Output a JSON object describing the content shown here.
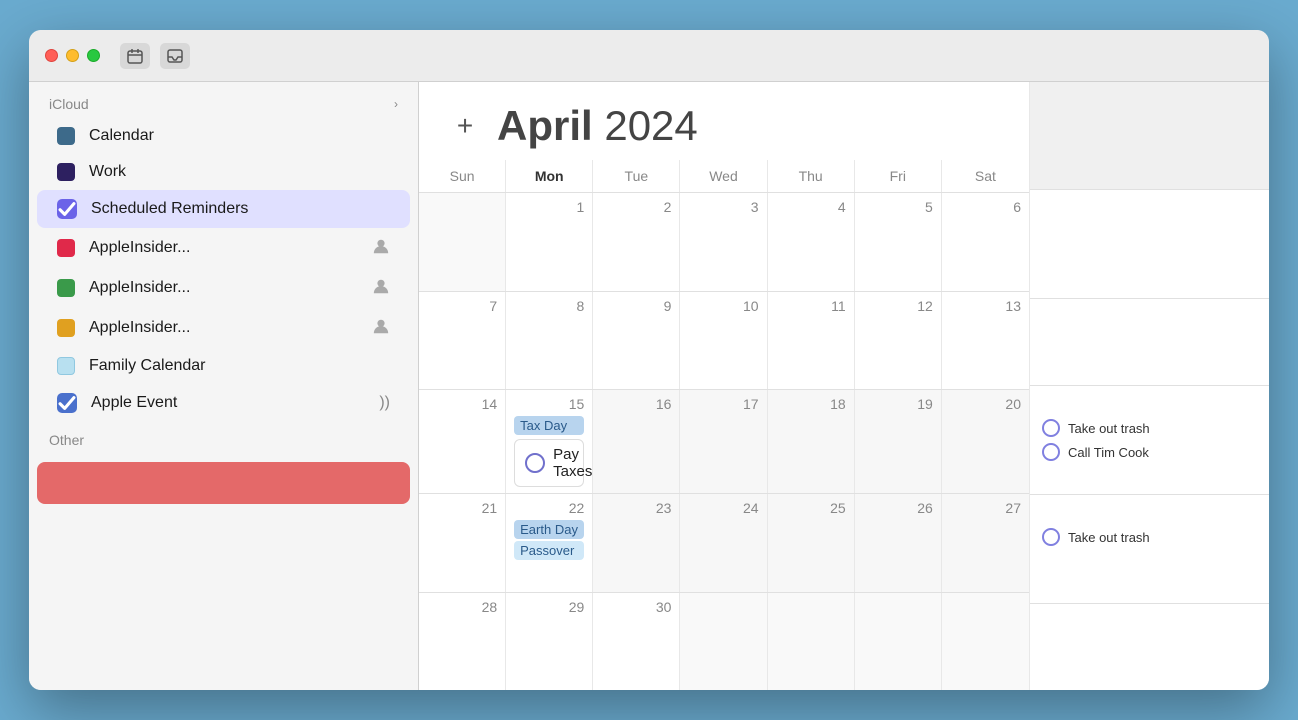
{
  "window": {
    "title": "Calendar"
  },
  "titlebar": {
    "close_label": "",
    "minimize_label": "",
    "maximize_label": ""
  },
  "sidebar": {
    "icloud_section": "iCloud",
    "chevron": "›",
    "items": [
      {
        "id": "calendar",
        "label": "Calendar",
        "color": "#3d6a8a",
        "type": "dot"
      },
      {
        "id": "work",
        "label": "Work",
        "color": "#2d2060",
        "type": "dot"
      },
      {
        "id": "scheduled-reminders",
        "label": "Scheduled Reminders",
        "color": "#6b63e8",
        "type": "checkbox",
        "selected": true
      },
      {
        "id": "appleinsider-red",
        "label": "AppleInsider...",
        "color": "#e0294a",
        "type": "dot",
        "badge": "person"
      },
      {
        "id": "appleinsider-green",
        "label": "AppleInsider...",
        "color": "#3a9a4a",
        "type": "dot",
        "badge": "person"
      },
      {
        "id": "appleinsider-yellow",
        "label": "AppleInsider...",
        "color": "#e0a020",
        "type": "dot",
        "badge": "person"
      },
      {
        "id": "family-calendar",
        "label": "Family Calendar",
        "color": "#b8e0f0",
        "type": "dot"
      },
      {
        "id": "apple-event",
        "label": "Apple Event",
        "color": "#4a70cc",
        "type": "checkbox",
        "badge": "sound"
      }
    ],
    "other_section": "Other",
    "add_button_label": "+"
  },
  "calendar": {
    "month": "April",
    "year": "2024",
    "add_button": "+",
    "day_headers": [
      "Sun",
      "Mon",
      "Tue",
      "Wed",
      "Thu",
      "Fri",
      "Sat"
    ],
    "weeks": [
      {
        "days": [
          {
            "number": "",
            "other": true
          },
          {
            "number": "1",
            "events": []
          },
          {
            "number": "2",
            "events": []
          },
          {
            "number": "3",
            "events": []
          },
          {
            "number": "4",
            "events": []
          },
          {
            "number": "5",
            "events": []
          },
          {
            "number": "6",
            "events": []
          }
        ]
      },
      {
        "days": [
          {
            "number": "7",
            "events": []
          },
          {
            "number": "8",
            "events": []
          },
          {
            "number": "9",
            "events": []
          },
          {
            "number": "10",
            "events": []
          },
          {
            "number": "11",
            "events": []
          },
          {
            "number": "12",
            "events": []
          },
          {
            "number": "13",
            "events": []
          }
        ]
      },
      {
        "days": [
          {
            "number": "14",
            "events": []
          },
          {
            "number": "15",
            "events": [
              {
                "label": "Tax Day",
                "type": "blue-bg"
              },
              {
                "label": "Pay Taxes",
                "type": "reminder"
              }
            ]
          },
          {
            "number": "",
            "other": true,
            "events": []
          },
          {
            "number": "",
            "other": true,
            "events": []
          },
          {
            "number": "",
            "other": true,
            "events": []
          },
          {
            "number": "",
            "other": true,
            "events": []
          },
          {
            "number": "",
            "other": true,
            "events": []
          }
        ]
      },
      {
        "days": [
          {
            "number": "21",
            "events": []
          },
          {
            "number": "22",
            "events": [
              {
                "label": "Earth Day",
                "type": "blue-bg"
              },
              {
                "label": "Passover",
                "type": "light-blue-bg"
              }
            ]
          },
          {
            "number": "",
            "other": true,
            "events": []
          },
          {
            "number": "",
            "other": true,
            "events": []
          },
          {
            "number": "",
            "other": true,
            "events": []
          },
          {
            "number": "",
            "other": true,
            "events": []
          },
          {
            "number": "",
            "other": true,
            "events": []
          }
        ]
      },
      {
        "days": [
          {
            "number": "28",
            "events": []
          },
          {
            "number": "29",
            "events": []
          },
          {
            "number": "30",
            "events": []
          },
          {
            "number": "",
            "other": true,
            "events": []
          },
          {
            "number": "",
            "other": true,
            "events": []
          },
          {
            "number": "",
            "other": true,
            "events": []
          },
          {
            "number": "",
            "other": true,
            "events": []
          }
        ]
      }
    ],
    "reminders_col_week1": {
      "items": [
        "Take out trash",
        "Call Tim Cook"
      ]
    },
    "reminders_col_week2": {
      "items": [
        "Take out trash"
      ]
    },
    "tax_day_label": "Tax Day",
    "pay_taxes_label": "Pay Taxes",
    "earth_day_label": "Earth Day",
    "passover_label": "Passover",
    "take_out_trash_label": "Take out trash",
    "call_tim_cook_label": "Call Tim Cook"
  }
}
